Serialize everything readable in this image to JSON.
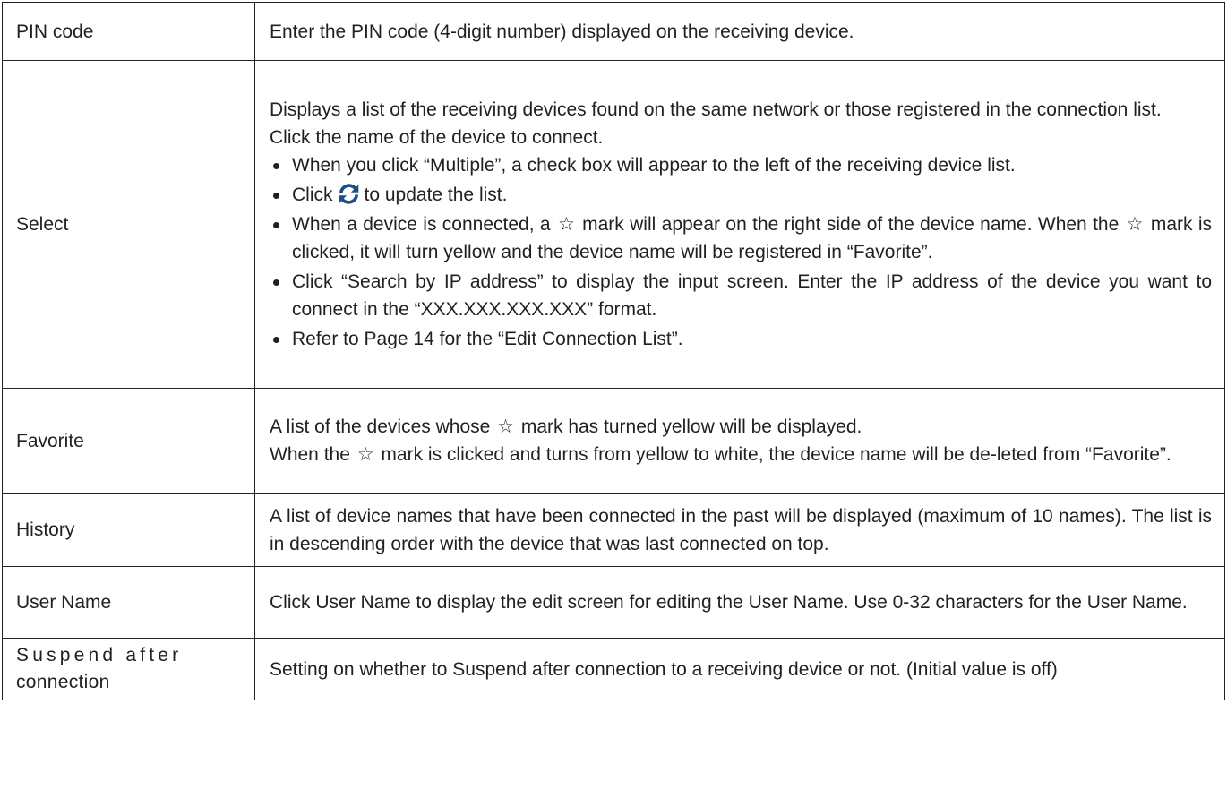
{
  "rows": {
    "pin": {
      "label": "PIN code",
      "text": "Enter the PIN code (4-digit number) displayed on the receiving device."
    },
    "select": {
      "label": "Select",
      "intro1": "Displays a list of the receiving devices found on the same network or those registered in the connection list.",
      "intro2": "Click the name of the device to connect.",
      "b1": "When you click “Multiple”, a check box will appear to the left of the receiving device list.",
      "b2_before": "Click",
      "b2_after": "to update the list.",
      "b3_a": "When a device is connected, a",
      "b3_b": "mark will appear on the right side of the device name. When the",
      "b3_c": "mark is clicked, it will turn yellow and the device name will be registered in “Favorite”.",
      "b4": "Click “Search by IP address” to display the input screen. Enter the IP address of the device you want to connect in the “XXX.XXX.XXX.XXX” format.",
      "b5": "Refer to Page 14 for the “Edit Connection List”."
    },
    "favorite": {
      "label": "Favorite",
      "l1_a": "A list of the devices whose",
      "l1_b": "mark has turned yellow will be displayed.",
      "l2_a": "When the",
      "l2_b": "mark is clicked and turns from yellow to white, the device name will be de-leted from “Favorite”."
    },
    "history": {
      "label": "History",
      "text": "A list of device names that have been connected in the past will be displayed (maximum of 10 names). The list is in descending order with the device that was last connected on top."
    },
    "username": {
      "label": "User Name",
      "text": "Click User Name to display the edit screen for editing the User Name. Use 0-32 characters for the User Name."
    },
    "suspend": {
      "label_line1": "Suspend after",
      "label_line2": "connection",
      "text": "Setting on whether to Suspend after connection to a receiving device or not. (Initial value is off)"
    }
  },
  "glyphs": {
    "star": "☆"
  },
  "colors": {
    "text": "#231f20",
    "refresh_icon": "#1a4f86"
  },
  "icons": {
    "refresh": "refresh-icon",
    "star": "star-outline-icon"
  }
}
